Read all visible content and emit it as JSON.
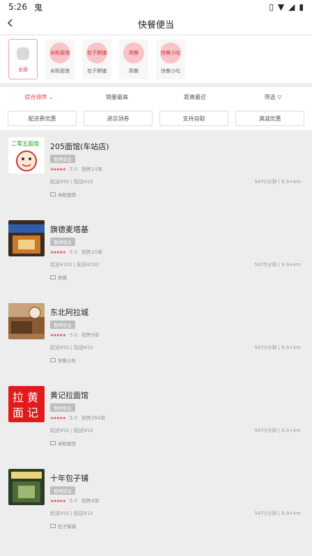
{
  "status_bar": {
    "time": "5:26",
    "icons": [
      "ghost-icon",
      "vibrate-icon",
      "wifi-icon",
      "signal-icon",
      "battery-icon"
    ]
  },
  "header": {
    "title": "快餐便当",
    "back_icon": "chevron-left-icon"
  },
  "categories": [
    {
      "label": "全部",
      "icon_text": "",
      "active": true
    },
    {
      "label": "米粉面馆",
      "icon_text": "米粉面馆"
    },
    {
      "label": "包子粥铺",
      "icon_text": "包子粥铺"
    },
    {
      "label": "简餐",
      "icon_text": "简餐"
    },
    {
      "label": "快餐小吃",
      "icon_text": "快餐小吃"
    }
  ],
  "sort": [
    {
      "label": "综合排序",
      "active": true
    },
    {
      "label": "销量最高"
    },
    {
      "label": "距离最近"
    },
    {
      "label": "筛选"
    }
  ],
  "filters": [
    "配送费优惠",
    "进店领券",
    "支持自取",
    "满减优惠"
  ],
  "stores": [
    {
      "name": "205面馆(车站店)",
      "status": "暂停营业",
      "rating": "5.0",
      "sales": "销售14单",
      "delivery": "起送¥50 | 配送¥10",
      "distance": "5470分钟 | 9.9+km",
      "tag": "米粉面馆",
      "thumb": "205"
    },
    {
      "name": "旗德麦塔基",
      "status": "暂停营业",
      "rating": "5.0",
      "sales": "销售20单",
      "delivery": "起送¥100 | 配送¥200",
      "distance": "5475分钟 | 9.9+km",
      "tag": "简餐",
      "thumb": "shop"
    },
    {
      "name": "东北阿拉城",
      "status": "暂停营业",
      "rating": "5.0",
      "sales": "销售9单",
      "delivery": "起送¥50 | 配送¥10",
      "distance": "5475分钟 | 9.9+km",
      "tag": "快餐小吃",
      "thumb": "interior"
    },
    {
      "name": "黄记拉面馆",
      "status": "暂停营业",
      "rating": "5.0",
      "sales": "销售264单",
      "delivery": "起送¥50 | 配送¥10",
      "distance": "5475分钟 | 9.9+km",
      "tag": "米粉面馆",
      "thumb": "黄记拉面"
    },
    {
      "name": "十年包子铺",
      "status": "暂停营业",
      "rating": "5.0",
      "sales": "销售8单",
      "delivery": "起送¥50 | 配送¥10",
      "distance": "5475分钟 | 9.9+km",
      "tag": "包子粥铺",
      "thumb": "shop2"
    }
  ]
}
